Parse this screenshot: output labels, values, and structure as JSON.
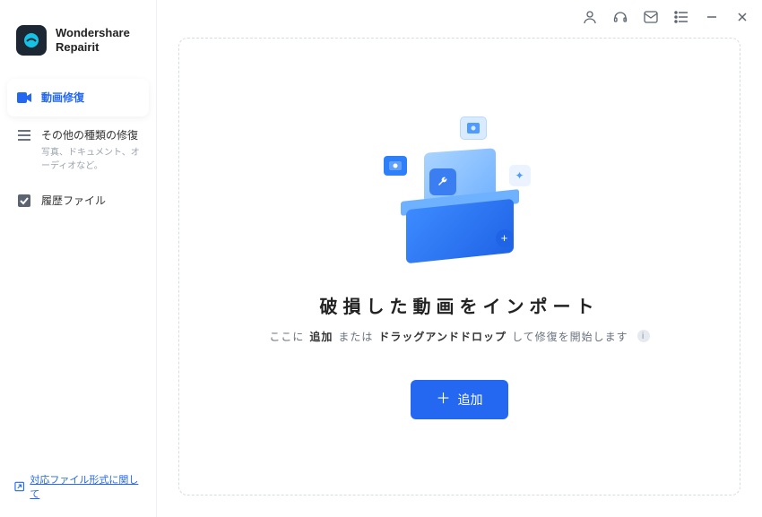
{
  "app": {
    "name_line1": "Wondershare",
    "name_line2": "Repairit"
  },
  "sidebar": {
    "items": [
      {
        "label": "動画修復",
        "sub": "",
        "icon": "video-icon",
        "active": true
      },
      {
        "label": "その他の種類の修復",
        "sub": "写真、ドキュメント、オーディオなど。",
        "icon": "list-icon",
        "active": false
      },
      {
        "label": "履歴ファイル",
        "sub": "",
        "icon": "check-icon",
        "active": false
      }
    ],
    "footer_link": "対応ファイル形式に関して"
  },
  "topbar": {
    "icons": [
      "user-icon",
      "headset-icon",
      "mail-icon",
      "menu-list-icon",
      "minimize-icon",
      "close-icon"
    ]
  },
  "dropzone": {
    "headline": "破損した動画をインポート",
    "sub_prefix": "ここに",
    "sub_strong1": "追加",
    "sub_mid": "または",
    "sub_strong2": "ドラッグアンドドロップ",
    "sub_suffix": "して修復を開始します",
    "add_label": "追加"
  }
}
